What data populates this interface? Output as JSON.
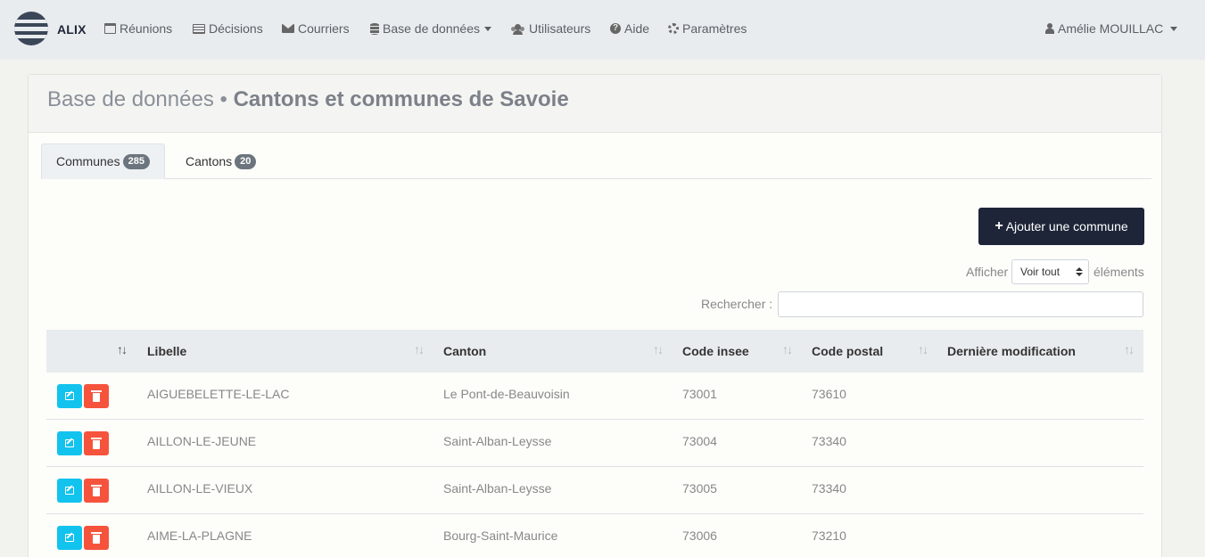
{
  "navbar": {
    "brand": "ALIX",
    "items": [
      {
        "label": "Réunions",
        "icon": "calendar-icon"
      },
      {
        "label": "Décisions",
        "icon": "list-icon"
      },
      {
        "label": "Courriers",
        "icon": "envelope-icon"
      },
      {
        "label": "Base de données",
        "icon": "database-icon"
      },
      {
        "label": "Utilisateurs",
        "icon": "users-icon"
      },
      {
        "label": "Aide",
        "icon": "question-circle-icon"
      },
      {
        "label": "Paramètres",
        "icon": "gear-icon"
      }
    ],
    "user": {
      "label": "Amélie MOUILLAC",
      "icon": "user-icon"
    }
  },
  "header": {
    "section": "Base de données",
    "separator": " • ",
    "title": "Cantons et communes de Savoie"
  },
  "tabs": [
    {
      "label": "Communes",
      "count": "285",
      "active": true
    },
    {
      "label": "Cantons",
      "count": "20",
      "active": false
    }
  ],
  "toolbar": {
    "add_label": "Ajouter une commune",
    "show_before": "Afficher",
    "show_value": "Voir tout",
    "show_after": "éléments",
    "search_label": "Rechercher :",
    "search_value": ""
  },
  "table": {
    "columns": [
      "Libelle",
      "Canton",
      "Code insee",
      "Code postal",
      "Dernière modification"
    ],
    "rows": [
      {
        "libelle": "AIGUEBELETTE-LE-LAC",
        "canton": "Le Pont-de-Beauvoisin",
        "insee": "73001",
        "postal": "73610",
        "modif": ""
      },
      {
        "libelle": "AILLON-LE-JEUNE",
        "canton": "Saint-Alban-Leysse",
        "insee": "73004",
        "postal": "73340",
        "modif": ""
      },
      {
        "libelle": "AILLON-LE-VIEUX",
        "canton": "Saint-Alban-Leysse",
        "insee": "73005",
        "postal": "73340",
        "modif": ""
      },
      {
        "libelle": "AIME-LA-PLAGNE",
        "canton": "Bourg-Saint-Maurice",
        "insee": "73006",
        "postal": "73210",
        "modif": ""
      }
    ]
  },
  "colors": {
    "brand_dark": "#1e2538",
    "edit": "#12c3ee",
    "delete": "#f6533d",
    "badge": "#6c757d"
  }
}
